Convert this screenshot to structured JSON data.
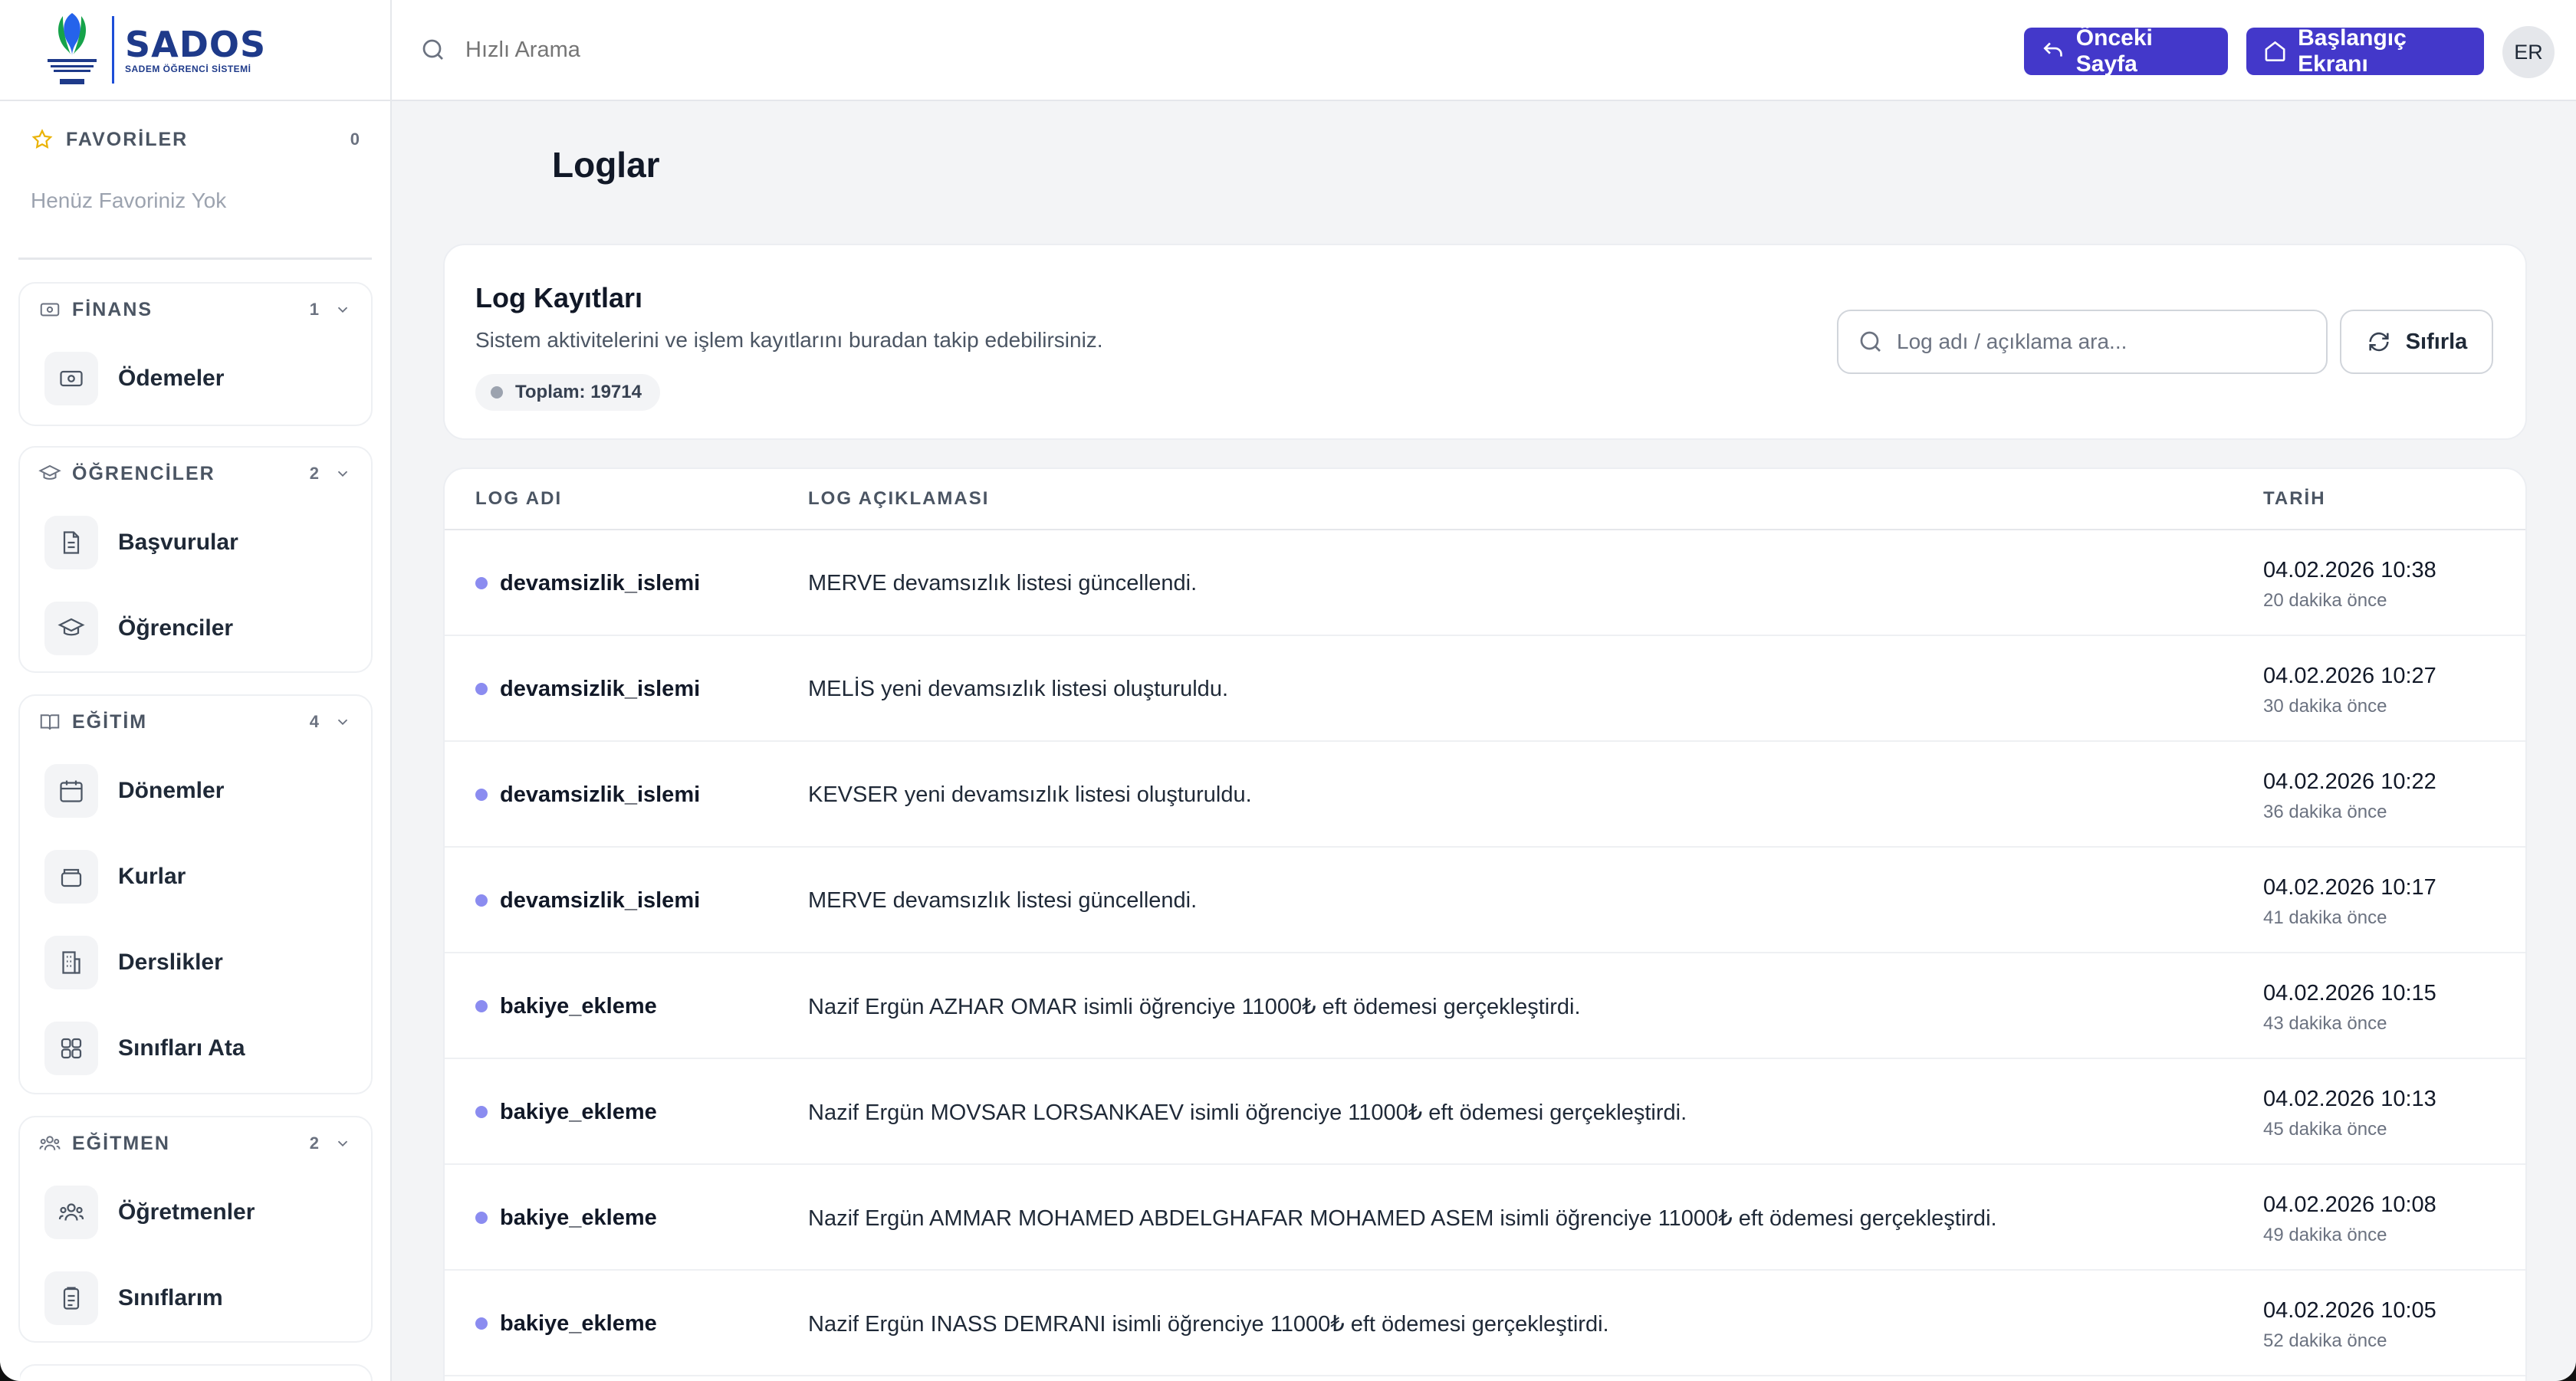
{
  "header": {
    "search_placeholder": "Hızlı Arama",
    "prev_page_label": "Önceki Sayfa",
    "home_label": "Başlangıç Ekranı",
    "avatar_initials": "ER",
    "accent_color": "#4338ca"
  },
  "logo": {
    "name": "SADOS",
    "subtitle": "SADEM ÖĞRENCİ SİSTEMİ"
  },
  "sidebar": {
    "favorites": {
      "title": "FAVORİLER",
      "count": "0",
      "empty_text": "Henüz Favoriniz Yok"
    },
    "groups": [
      {
        "title": "FİNANS",
        "count": "1",
        "icon": "banknote-icon",
        "items": [
          {
            "label": "Ödemeler",
            "icon": "money-icon"
          }
        ]
      },
      {
        "title": "ÖĞRENCİLER",
        "count": "2",
        "icon": "graduation-cap-icon",
        "items": [
          {
            "label": "Başvurular",
            "icon": "document-icon"
          },
          {
            "label": "Öğrenciler",
            "icon": "graduation-cap-icon"
          }
        ]
      },
      {
        "title": "EĞİTİM",
        "count": "4",
        "icon": "book-icon",
        "items": [
          {
            "label": "Dönemler",
            "icon": "calendar-icon"
          },
          {
            "label": "Kurlar",
            "icon": "layers-icon"
          },
          {
            "label": "Derslikler",
            "icon": "building-icon"
          },
          {
            "label": "Sınıfları Ata",
            "icon": "grid-icon"
          }
        ]
      },
      {
        "title": "EĞİTMEN",
        "count": "2",
        "icon": "users-icon",
        "items": [
          {
            "label": "Öğretmenler",
            "icon": "users-icon"
          },
          {
            "label": "Sınıflarım",
            "icon": "clipboard-icon"
          }
        ]
      }
    ]
  },
  "page": {
    "title": "Loglar"
  },
  "logs_card": {
    "title": "Log Kayıtları",
    "description": "Sistem aktivitelerini ve işlem kayıtlarını buradan takip edebilirsiniz.",
    "total_label": "Toplam: 19714",
    "search_placeholder": "Log adı / açıklama ara...",
    "reset_label": "Sıfırla"
  },
  "table": {
    "headers": {
      "name": "LOG ADI",
      "description": "LOG AÇIKLAMASI",
      "date": "TARİH"
    },
    "rows": [
      {
        "name": "devamsizlik_islemi",
        "description": "MERVE devamsızlık listesi güncellendi.",
        "date": "04.02.2026 10:38",
        "ago": "20 dakika önce"
      },
      {
        "name": "devamsizlik_islemi",
        "description": "MELİS yeni devamsızlık listesi oluşturuldu.",
        "date": "04.02.2026 10:27",
        "ago": "30 dakika önce"
      },
      {
        "name": "devamsizlik_islemi",
        "description": "KEVSER yeni devamsızlık listesi oluşturuldu.",
        "date": "04.02.2026 10:22",
        "ago": "36 dakika önce"
      },
      {
        "name": "devamsizlik_islemi",
        "description": "MERVE devamsızlık listesi güncellendi.",
        "date": "04.02.2026 10:17",
        "ago": "41 dakika önce"
      },
      {
        "name": "bakiye_ekleme",
        "description": "Nazif Ergün AZHAR OMAR isimli öğrenciye 11000₺ eft ödemesi gerçekleştirdi.",
        "date": "04.02.2026 10:15",
        "ago": "43 dakika önce"
      },
      {
        "name": "bakiye_ekleme",
        "description": "Nazif Ergün MOVSAR LORSANKAEV isimli öğrenciye 11000₺ eft ödemesi gerçekleştirdi.",
        "date": "04.02.2026 10:13",
        "ago": "45 dakika önce"
      },
      {
        "name": "bakiye_ekleme",
        "description": "Nazif Ergün AMMAR MOHAMED ABDELGHAFAR MOHAMED ASEM isimli öğrenciye 11000₺ eft ödemesi gerçekleştirdi.",
        "date": "04.02.2026 10:08",
        "ago": "49 dakika önce"
      },
      {
        "name": "bakiye_ekleme",
        "description": "Nazif Ergün INASS DEMRANI isimli öğrenciye 11000₺ eft ödemesi gerçekleştirdi.",
        "date": "04.02.2026 10:05",
        "ago": "52 dakika önce"
      }
    ]
  }
}
